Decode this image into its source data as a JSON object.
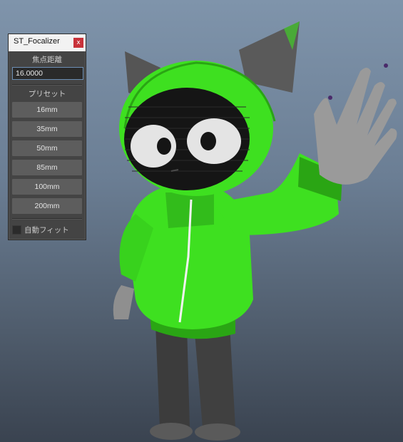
{
  "window": {
    "title": "ST_Focalizer",
    "close_glyph": "x",
    "focal_length_label": "焦点距離",
    "focal_length_value": "16.0000",
    "preset_label": "プリセット",
    "presets": [
      "16mm",
      "35mm",
      "50mm",
      "85mm",
      "100mm",
      "200mm"
    ],
    "auto_fit_label": "自動フィット",
    "auto_fit_checked": false
  },
  "colors": {
    "hoodie_green": "#3ee020",
    "viewport_top": "#7f94ab",
    "viewport_bottom": "#3a4350"
  }
}
